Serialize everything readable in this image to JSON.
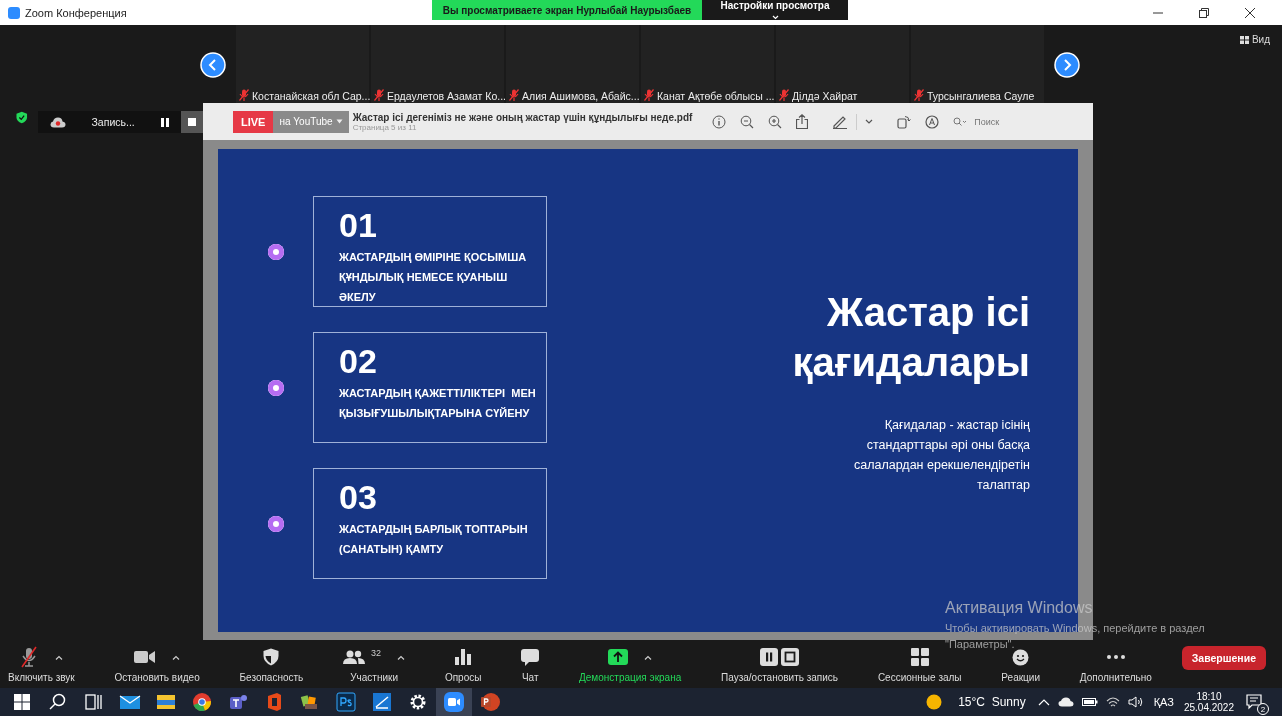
{
  "window": {
    "title": "Zoom Конференция",
    "banner": "Вы просматриваете экран Нурлыбай Наурызбаев",
    "view_settings": "Настройки просмотра"
  },
  "view_button": "Вид",
  "participants": [
    {
      "name": "Костанайская обл Сар...",
      "muted": true
    },
    {
      "name": "Ердаулетов Азамат Ко...",
      "muted": true
    },
    {
      "name": "Алия Ашимова, Абайс...",
      "muted": true
    },
    {
      "name": "Канат Ақтөбе облысы ...",
      "muted": true
    },
    {
      "name": "Ділдә Хайрат",
      "muted": true
    },
    {
      "name": "Турсынгалиева Сауле",
      "muted": true
    }
  ],
  "recording": {
    "label": "Запись...",
    "live": "LIVE",
    "live_target": "на YouTube"
  },
  "pdf": {
    "filename": "Жастар ісі дегеніміз не және оның жастар үшін құндылығы неде.pdf",
    "page": "Страница 5 из 11",
    "search_placeholder": "Поиск"
  },
  "slide": {
    "items": [
      {
        "number": "01",
        "text": "ЖАСТАРДЫҢ ӨМІРІНЕ ҚОСЫМША ҚҰНДЫЛЫҚ НЕМЕСЕ ҚУАНЫШ ӘКЕЛУ"
      },
      {
        "number": "02",
        "text": "ЖАСТАРДЫҢ ҚАЖЕТТІЛІКТЕРІ  МЕН ҚЫЗЫҒУШЫЛЫҚТАРЫНА СҮЙЕНУ"
      },
      {
        "number": "03",
        "text": "ЖАСТАРДЫҢ БАРЛЫҚ ТОПТАРЫН (САНАТЫН) ҚАМТУ"
      }
    ],
    "title": "Жастар ісі қағидалары",
    "subtitle": "Қағидалар - жастар ісінің стандарттары әрі оны басқа салалардан ерекшелендіретін талаптар"
  },
  "activation": {
    "title": "Активация Windows",
    "text": "Чтобы активировать Windows, перейдите в раздел \"Параметры\"."
  },
  "toolbar": [
    {
      "kind": "mic",
      "label": "Включить звук",
      "caret": true,
      "muted": true
    },
    {
      "kind": "video",
      "label": "Остановить видео",
      "caret": true
    },
    {
      "kind": "security",
      "label": "Безопасность",
      "caret": false
    },
    {
      "kind": "participants",
      "label": "Участники",
      "caret": true,
      "count": "32"
    },
    {
      "kind": "polls",
      "label": "Опросы",
      "caret": false
    },
    {
      "kind": "chat",
      "label": "Чат",
      "caret": false
    },
    {
      "kind": "share",
      "label": "Демонстрация экрана",
      "caret": true,
      "active": true
    },
    {
      "kind": "record",
      "label": "Пауза/остановить запись",
      "caret": false
    },
    {
      "kind": "rooms",
      "label": "Сессионные залы",
      "caret": false
    },
    {
      "kind": "reactions",
      "label": "Реакции",
      "caret": false
    },
    {
      "kind": "more",
      "label": "Дополнительно",
      "caret": false
    }
  ],
  "end_button": "Завершение",
  "taskbar": {
    "apps": [
      {
        "kind": "search",
        "selected": false
      },
      {
        "kind": "taskview",
        "selected": false
      },
      {
        "kind": "mail",
        "selected": false
      },
      {
        "kind": "folder",
        "selected": false
      },
      {
        "kind": "chrome",
        "selected": false
      },
      {
        "kind": "teams",
        "selected": false
      },
      {
        "kind": "office",
        "selected": false
      },
      {
        "kind": "game",
        "selected": false
      },
      {
        "kind": "ps",
        "selected": false
      },
      {
        "kind": "scan",
        "selected": false
      },
      {
        "kind": "settings",
        "selected": false
      },
      {
        "kind": "zoom",
        "selected": true
      },
      {
        "kind": "powerpoint",
        "selected": false
      }
    ],
    "weather": "15°C  Sunny",
    "language": "ҚАЗ",
    "time": "18:10",
    "date": "25.04.2022",
    "notifications": "2"
  }
}
